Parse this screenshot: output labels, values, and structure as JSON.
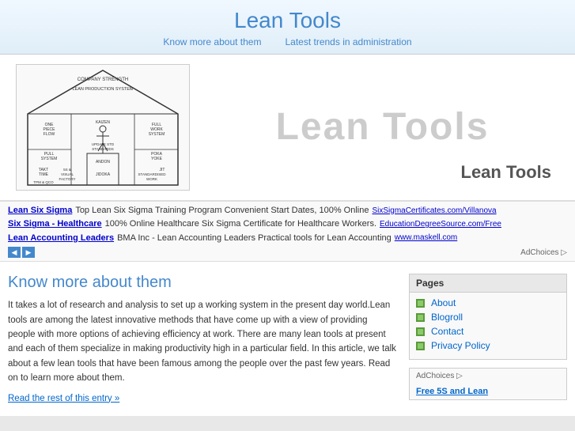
{
  "header": {
    "title": "Lean Tools",
    "nav": [
      {
        "label": "Know more about them",
        "href": "#"
      },
      {
        "label": "Latest trends in administration",
        "href": "#"
      }
    ]
  },
  "hero": {
    "big_text": "Lean Tools",
    "small_text": "Lean Tools",
    "house_labels": {
      "top": "COMPANY STRENGTH",
      "system": "LEAN PRODUCTION SYSTEM",
      "items": [
        "ONE PIECE FLOW",
        "KAIZEN",
        "FULL WORK SYSTEM",
        "PULL SYSTEM",
        "UPDATE STD STANDARDS",
        "POKA YOKE",
        "TAKT TIME",
        "ANDON",
        "JIT",
        "5S & VISUAL FACTORY",
        "JIDOKA",
        "STANDARDISED WORK",
        "TPM & QCO"
      ]
    }
  },
  "ads": [
    {
      "bold_link": "Lean Six Sigma",
      "text": "Top Lean Six Sigma Training Program Convenient Start Dates, 100% Online",
      "small_link": "SixSigmaCertificates.com/Villanova"
    },
    {
      "bold_link": "Six Sigma - Healthcare",
      "text": "100% Online Healthcare Six Sigma Certificate for Healthcare Workers.",
      "small_link": "EducationDegreeSource.com/Free"
    },
    {
      "bold_link": "Lean Accounting Leaders",
      "text": "BMA Inc - Lean Accounting Leaders Practical tools for Lean Accounting",
      "small_link": "www.maskell.com"
    }
  ],
  "adchoices_label": "AdChoices ▷",
  "content": {
    "heading": "Know more about them",
    "body": "It takes a lot of research and analysis to set up a working system in the present day world.Lean tools are among the latest innovative methods that have come up with a view of providing people with more options of achieving efficiency at work. There are many lean tools at present and each of them specialize in making productivity high in a particular field. In this article, we talk about a few lean tools that have been famous among the people over the past few years. Read on to learn more about them.",
    "read_more": "Read the rest of this entry »"
  },
  "sidebar": {
    "pages_title": "Pages",
    "pages": [
      {
        "label": "About"
      },
      {
        "label": "Blogroll"
      },
      {
        "label": "Contact"
      },
      {
        "label": "Privacy Policy"
      }
    ],
    "adchoices": "AdChoices ▷",
    "ad_title": "Free 5S and Lean"
  }
}
